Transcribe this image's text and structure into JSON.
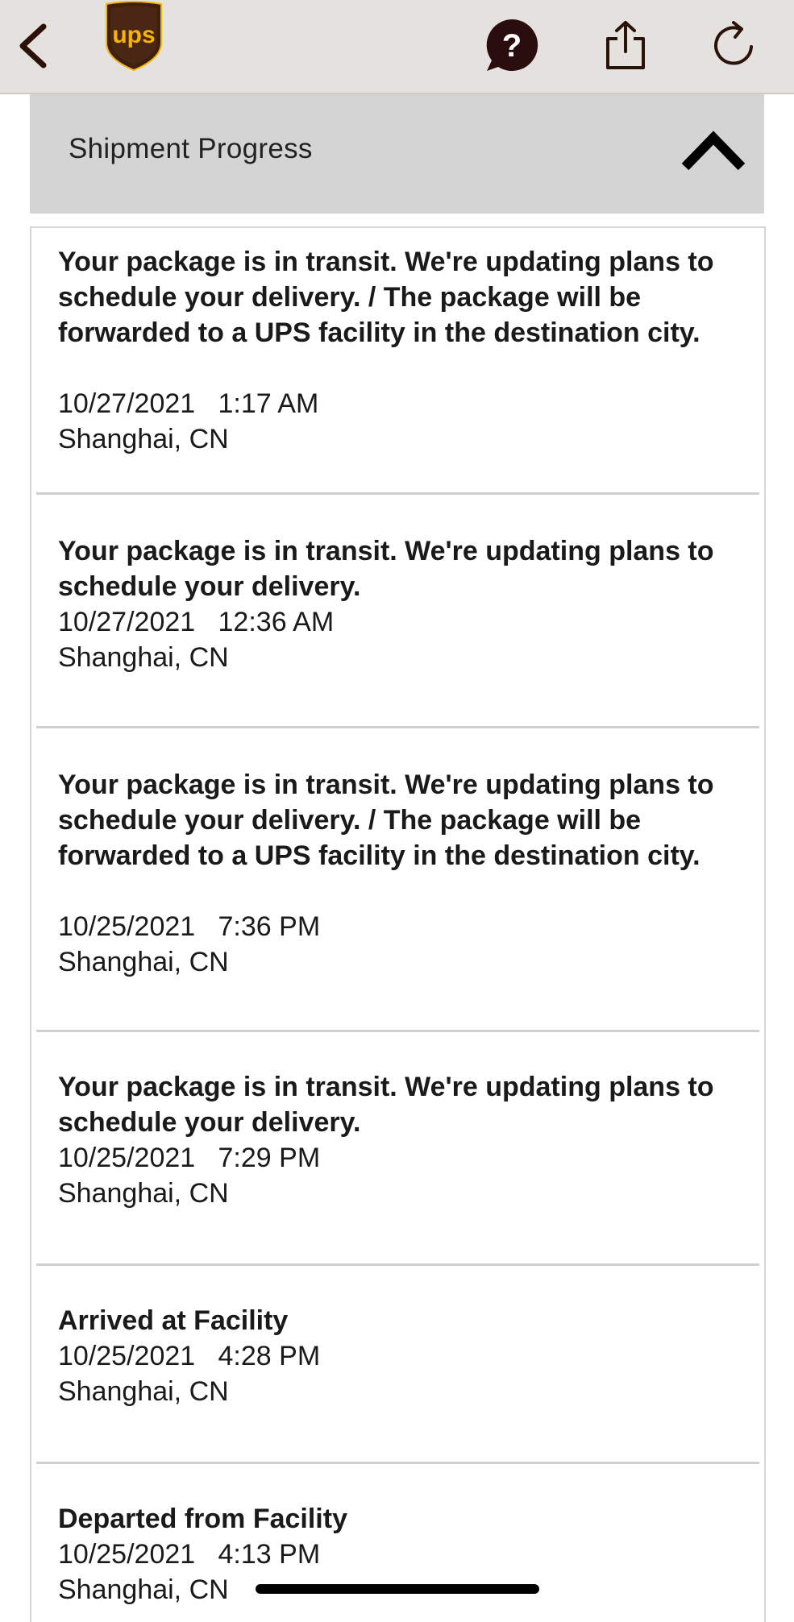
{
  "topbar": {
    "back_icon": "chevron-left-icon",
    "logo_text": "ups",
    "help_symbol": "?",
    "share_icon": "share-icon",
    "refresh_icon": "refresh-icon",
    "colors": {
      "bar": "#e4e1de",
      "logo_brown": "#3d1f10",
      "logo_gold": "#f5b400"
    }
  },
  "section": {
    "title": "Shipment Progress",
    "collapse_icon": "chevron-up-icon"
  },
  "events": [
    {
      "description": "Your package is in transit. We're updating plans to schedule your delivery. / The package will be forwarded to a UPS facility in the destination city.",
      "date": "10/27/2021",
      "time": "1:17 AM",
      "location": "Shanghai, CN"
    },
    {
      "description": "Your package is in transit. We're updating plans to schedule your delivery.",
      "date": "10/27/2021",
      "time": "12:36 AM",
      "location": "Shanghai, CN"
    },
    {
      "description": "Your package is in transit. We're updating plans to schedule your delivery. / The package will be forwarded to a UPS facility in the destination city.",
      "date": "10/25/2021",
      "time": "7:36 PM",
      "location": "Shanghai, CN"
    },
    {
      "description": "Your package is in transit. We're updating plans to schedule your delivery.",
      "date": "10/25/2021",
      "time": "7:29 PM",
      "location": "Shanghai, CN"
    },
    {
      "description": "Arrived at Facility",
      "date": "10/25/2021",
      "time": "4:28 PM",
      "location": "Shanghai, CN"
    },
    {
      "description": "Departed from Facility",
      "date": "10/25/2021",
      "time": "4:13 PM",
      "location": "Shanghai, CN"
    }
  ]
}
